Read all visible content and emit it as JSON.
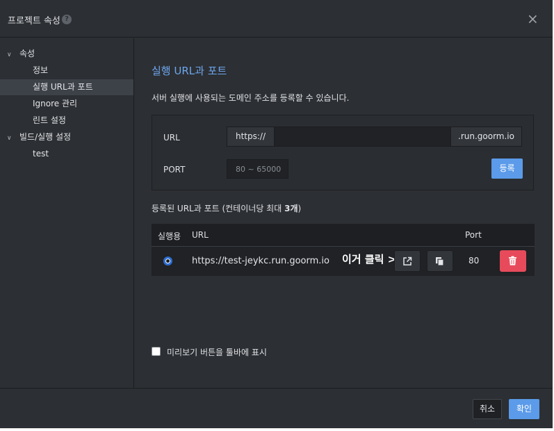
{
  "dialog": {
    "title": "프로젝트 속성",
    "help_icon": "question-circle-icon",
    "close_symbol": "×"
  },
  "sidebar": {
    "groups": [
      {
        "label": "속성",
        "items": [
          "정보",
          "실행 URL과 포트",
          "Ignore 관리",
          "린트 설정"
        ]
      },
      {
        "label": "빌드/실행 설정",
        "items": [
          "test"
        ]
      }
    ],
    "active_item": "실행 URL과 포트"
  },
  "main": {
    "heading": "실행 URL과 포트",
    "description": "서버 실행에 사용되는 도메인 주소를 등록할 수 있습니다.",
    "form": {
      "url_label": "URL",
      "url_prefix": "https://",
      "url_value": "",
      "url_suffix": ".run.goorm.io",
      "port_label": "PORT",
      "port_placeholder": "80 ~ 65000",
      "register_button": "등록"
    },
    "registered_title": "등록된 URL과 포트 (컨테이너당 최대 ",
    "registered_max": "3개",
    "registered_close": ")",
    "table": {
      "headers": {
        "run": "실행용",
        "url": "URL",
        "port": "Port"
      },
      "rows": [
        {
          "selected": true,
          "url": "https://test-jeykc.run.goorm.io",
          "port": "80"
        }
      ]
    },
    "annotation": "이거 클릭 >",
    "preview_checkbox_label": "미리보기 버튼을 툴바에 표시",
    "preview_checked": false
  },
  "footer": {
    "cancel": "취소",
    "confirm": "확인"
  },
  "colors": {
    "accent": "#5b9be9",
    "danger": "#e74b5b",
    "dialog_bg": "#2c2f33"
  }
}
